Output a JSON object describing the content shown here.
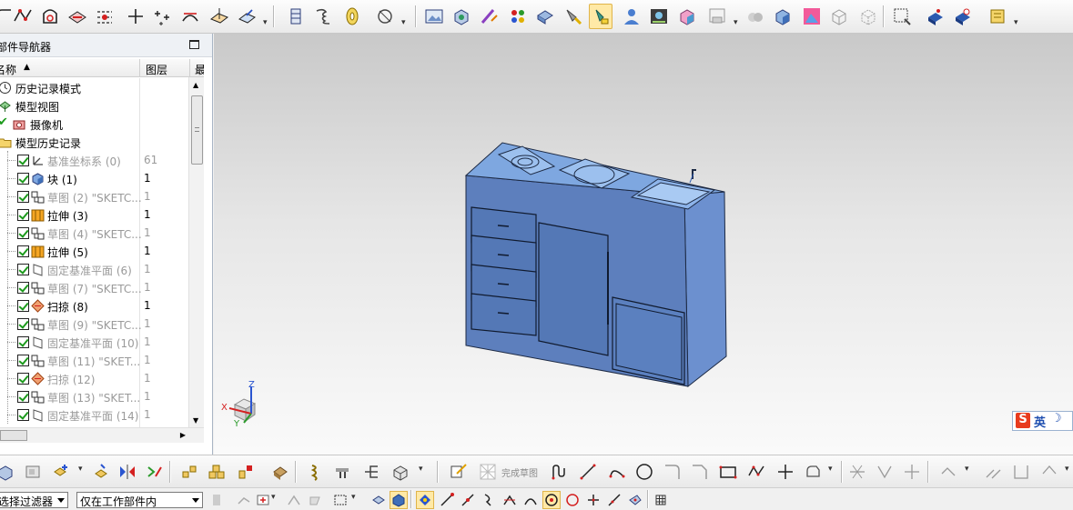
{
  "navigator": {
    "title": "部件导航器",
    "col_name": "名称",
    "col_layer": "图层",
    "col_extra": "最新"
  },
  "tree": [
    {
      "label": "历史记录模式",
      "layer": "",
      "dim": false,
      "icon": "clock-icon",
      "level": 0
    },
    {
      "label": "模型视图",
      "layer": "",
      "dim": false,
      "icon": "model-views-icon",
      "level": 0
    },
    {
      "label": "摄像机",
      "layer": "",
      "dim": false,
      "icon": "camera-icon",
      "level": 0
    },
    {
      "label": "模型历史记录",
      "layer": "",
      "dim": false,
      "icon": "folder-icon",
      "level": 0
    },
    {
      "label": "基准坐标系 (0)",
      "layer": "61",
      "dim": true,
      "icon": "datum-csys-icon",
      "level": 1
    },
    {
      "label": "块 (1)",
      "layer": "1",
      "dim": false,
      "icon": "block-icon",
      "level": 1
    },
    {
      "label": "草图 (2) \"SKETC...",
      "layer": "1",
      "dim": true,
      "icon": "sketch-icon",
      "level": 1
    },
    {
      "label": "拉伸 (3)",
      "layer": "1",
      "dim": false,
      "icon": "extrude-icon",
      "level": 1
    },
    {
      "label": "草图 (4) \"SKETC...",
      "layer": "1",
      "dim": true,
      "icon": "sketch-icon",
      "level": 1
    },
    {
      "label": "拉伸 (5)",
      "layer": "1",
      "dim": false,
      "icon": "extrude-icon",
      "level": 1
    },
    {
      "label": "固定基准平面 (6)",
      "layer": "1",
      "dim": true,
      "icon": "datum-plane-icon",
      "level": 1
    },
    {
      "label": "草图 (7) \"SKETC...",
      "layer": "1",
      "dim": true,
      "icon": "sketch-icon",
      "level": 1
    },
    {
      "label": "扫掠 (8)",
      "layer": "1",
      "dim": false,
      "icon": "sweep-icon",
      "level": 1
    },
    {
      "label": "草图 (9) \"SKETC...",
      "layer": "1",
      "dim": true,
      "icon": "sketch-icon",
      "level": 1
    },
    {
      "label": "固定基准平面 (10)",
      "layer": "1",
      "dim": true,
      "icon": "datum-plane-icon",
      "level": 1
    },
    {
      "label": "草图 (11) \"SKET...",
      "layer": "1",
      "dim": true,
      "icon": "sketch-icon",
      "level": 1
    },
    {
      "label": "扫掠 (12)",
      "layer": "1",
      "dim": true,
      "icon": "sweep-icon",
      "level": 1
    },
    {
      "label": "草图 (13) \"SKET...",
      "layer": "1",
      "dim": true,
      "icon": "sketch-icon",
      "level": 1
    },
    {
      "label": "固定基准平面 (14)",
      "layer": "1",
      "dim": true,
      "icon": "datum-plane-icon",
      "level": 1
    }
  ],
  "viewport": {
    "triad": {
      "x": "X",
      "y": "Y",
      "z": "Z"
    }
  },
  "ime": {
    "logo": "S",
    "lang": "英",
    "moon": "☽"
  },
  "bottom": {
    "finish_sketch_label": "完成草图",
    "filter_select": "选择过滤器",
    "scope_select": "仅在工作部件内"
  },
  "colors": {
    "cabinet": "#5b7fb8",
    "cabinet_dark": "#4a6ba3",
    "cabinet_top": "#7ea1d6",
    "accent_red": "#d42020",
    "check_green": "#1c9a1c"
  }
}
